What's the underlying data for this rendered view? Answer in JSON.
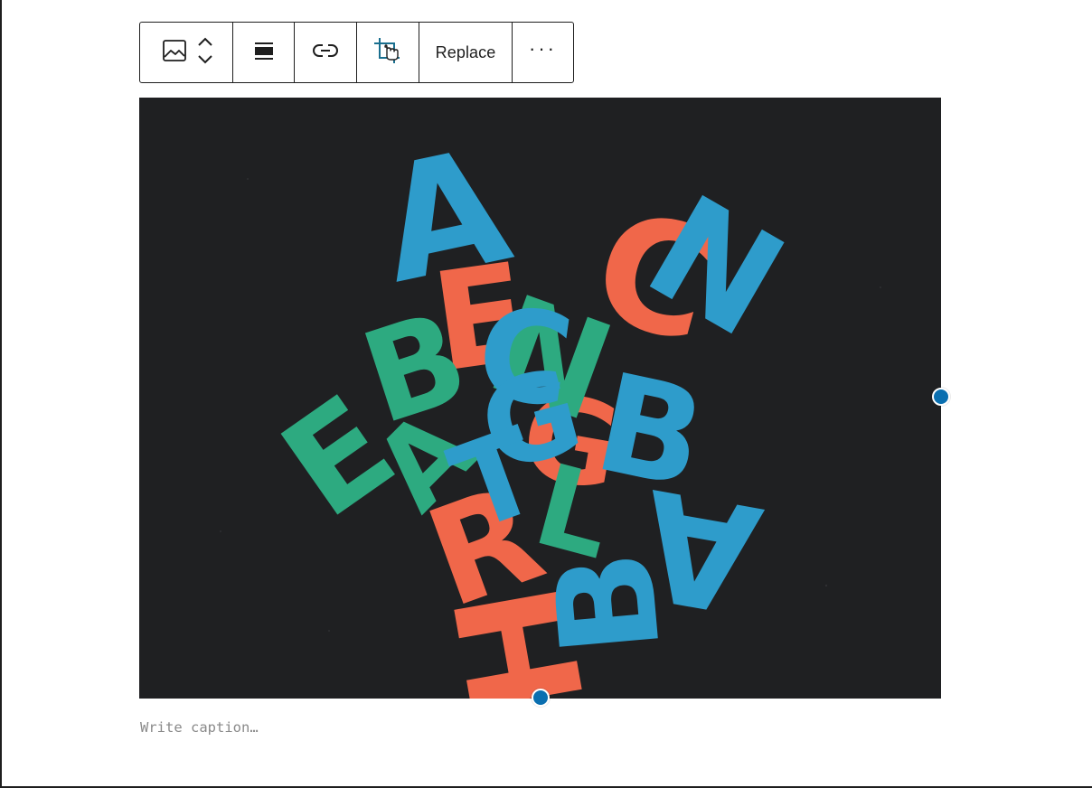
{
  "toolbar": {
    "block_icon": "image-icon",
    "move_up_icon": "chevron-up-icon",
    "move_down_icon": "chevron-down-icon",
    "align_icon": "align-center-icon",
    "link_icon": "link-icon",
    "crop_icon": "crop-icon",
    "replace_label": "Replace",
    "more_label": "···",
    "more_icon": "more-options-icon"
  },
  "image": {
    "subject_icon": "paper-letters-photo",
    "letters": [
      "A",
      "N",
      "B",
      "C",
      "G",
      "T",
      "L",
      "B",
      "A",
      "E",
      "R",
      "H",
      "B"
    ],
    "palette": {
      "background": "#1f2022",
      "blue": "#2e9ccb",
      "green": "#2daa80",
      "orange": "#f0674a"
    }
  },
  "caption": {
    "placeholder": "Write caption…"
  },
  "colors": {
    "accent": "#0a6fb0",
    "text": "#1e1e1e",
    "placeholder": "#8a8a8a"
  }
}
